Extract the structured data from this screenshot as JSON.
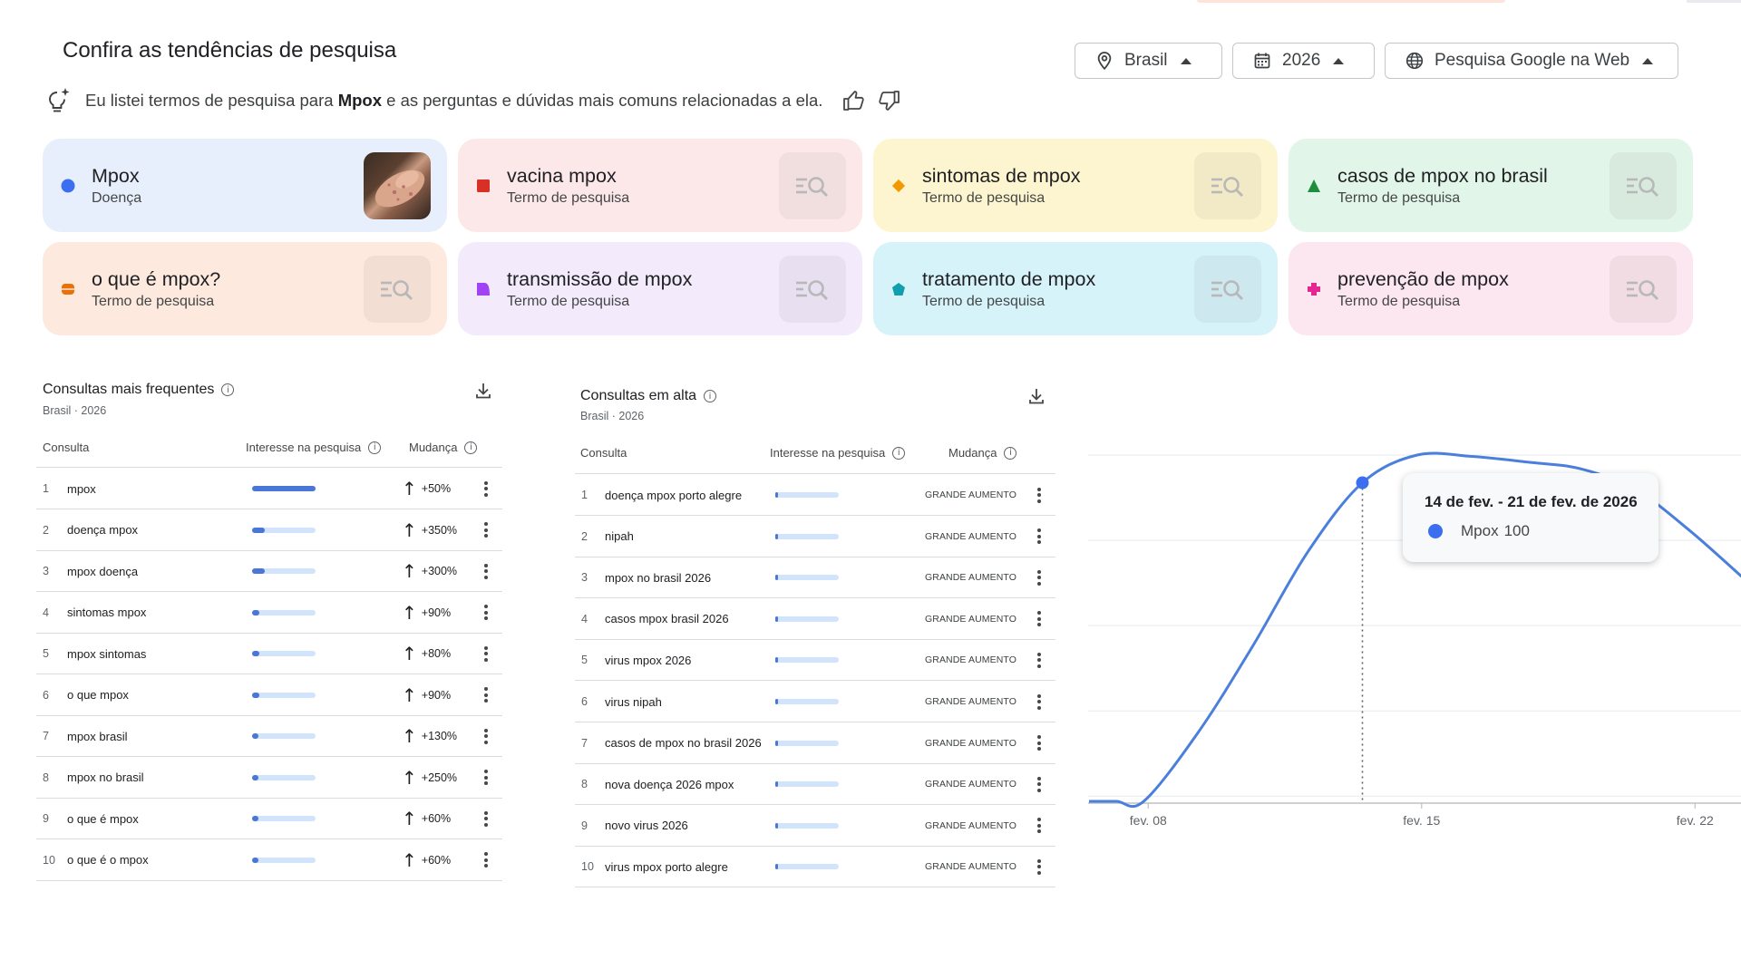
{
  "header": {
    "title": "Confira as tendências de pesquisa",
    "filters": {
      "location": "Brasil",
      "year": "2026",
      "property": "Pesquisa Google na Web"
    }
  },
  "ai_summary": {
    "prefix": "Eu listei termos de pesquisa para ",
    "term": "Mpox",
    "suffix": " e as perguntas e dúvidas mais comuns relacionadas a ela."
  },
  "cards": [
    {
      "title": "Mpox",
      "subtitle": "Doença",
      "bg": "#e8effc",
      "shape": "circle",
      "color": "#3b6ff0",
      "thumb": "photo"
    },
    {
      "title": "vacina mpox",
      "subtitle": "Termo de pesquisa",
      "bg": "#fce8e8",
      "shape": "square",
      "color": "#d93025",
      "thumb": "search-icon"
    },
    {
      "title": "sintomas de mpox",
      "subtitle": "Termo de pesquisa",
      "bg": "#fdf5cf",
      "shape": "diamond",
      "color": "#f29900",
      "thumb": "search-icon"
    },
    {
      "title": "casos de mpox no brasil",
      "subtitle": "Termo de pesquisa",
      "bg": "#e2f5e9",
      "shape": "triangle",
      "color": "#1e8e3e",
      "thumb": "search-icon"
    },
    {
      "title": "o que é mpox?",
      "subtitle": "Termo de pesquisa",
      "bg": "#fde9dd",
      "shape": "rounded",
      "color": "#e8710a",
      "thumb": "search-icon"
    },
    {
      "title": "transmissão de mpox",
      "subtitle": "Termo de pesquisa",
      "bg": "#f3eafc",
      "shape": "leaf",
      "color": "#a142f4",
      "thumb": "search-icon"
    },
    {
      "title": "tratamento de mpox",
      "subtitle": "Termo de pesquisa",
      "bg": "#d7f3fa",
      "shape": "pentagon",
      "color": "#129eaf",
      "thumb": "search-icon"
    },
    {
      "title": "prevenção de mpox",
      "subtitle": "Termo de pesquisa",
      "bg": "#fce6ef",
      "shape": "cross",
      "color": "#e52592",
      "thumb": "search-icon"
    }
  ],
  "top_queries": {
    "title": "Consultas mais frequentes",
    "subtitle": "Brasil · 2026",
    "col_query": "Consulta",
    "col_interest": "Interesse na pesquisa",
    "col_change": "Mudança",
    "rows": [
      {
        "rank": "1",
        "query": "mpox",
        "interest": 1.0,
        "change": "+50%"
      },
      {
        "rank": "2",
        "query": "doença mpox",
        "interest": 0.2,
        "change": "+350%"
      },
      {
        "rank": "3",
        "query": "mpox doença",
        "interest": 0.2,
        "change": "+300%"
      },
      {
        "rank": "4",
        "query": "sintomas mpox",
        "interest": 0.12,
        "change": "+90%"
      },
      {
        "rank": "5",
        "query": "mpox sintomas",
        "interest": 0.12,
        "change": "+80%"
      },
      {
        "rank": "6",
        "query": "o que mpox",
        "interest": 0.12,
        "change": "+90%"
      },
      {
        "rank": "7",
        "query": "mpox brasil",
        "interest": 0.1,
        "change": "+130%"
      },
      {
        "rank": "8",
        "query": "mpox no brasil",
        "interest": 0.1,
        "change": "+250%"
      },
      {
        "rank": "9",
        "query": "o que é mpox",
        "interest": 0.1,
        "change": "+60%"
      },
      {
        "rank": "10",
        "query": "o que é o mpox",
        "interest": 0.1,
        "change": "+60%"
      }
    ]
  },
  "rising_queries": {
    "title": "Consultas em alta",
    "subtitle": "Brasil · 2026",
    "col_query": "Consulta",
    "col_interest": "Interesse na pesquisa",
    "col_change": "Mudança",
    "rows": [
      {
        "rank": "1",
        "query": "doença mpox porto alegre",
        "interest": 0.02,
        "change": "GRANDE AUMENTO"
      },
      {
        "rank": "2",
        "query": "nipah",
        "interest": 0.02,
        "change": "GRANDE AUMENTO"
      },
      {
        "rank": "3",
        "query": "mpox no brasil 2026",
        "interest": 0.02,
        "change": "GRANDE AUMENTO"
      },
      {
        "rank": "4",
        "query": "casos mpox brasil 2026",
        "interest": 0.02,
        "change": "GRANDE AUMENTO"
      },
      {
        "rank": "5",
        "query": "virus mpox 2026",
        "interest": 0.02,
        "change": "GRANDE AUMENTO"
      },
      {
        "rank": "6",
        "query": "virus nipah",
        "interest": 0.02,
        "change": "GRANDE AUMENTO"
      },
      {
        "rank": "7",
        "query": "casos de mpox no brasil 2026",
        "interest": 0.02,
        "change": "GRANDE AUMENTO"
      },
      {
        "rank": "8",
        "query": "nova doença 2026 mpox",
        "interest": 0.02,
        "change": "GRANDE AUMENTO"
      },
      {
        "rank": "9",
        "query": "novo virus 2026",
        "interest": 0.02,
        "change": "GRANDE AUMENTO"
      },
      {
        "rank": "10",
        "query": "virus mpox porto alegre",
        "interest": 0.02,
        "change": "GRANDE AUMENTO"
      }
    ]
  },
  "chart_data": {
    "type": "line",
    "x_ticks": [
      "fev. 08",
      "fev. 15",
      "fev. 22"
    ],
    "series": [
      {
        "name": "Mpox",
        "color": "#4a7fdc",
        "points": [
          [
            0,
            0
          ],
          [
            0.5,
            0
          ],
          [
            1,
            0
          ],
          [
            2,
            20
          ],
          [
            3,
            45
          ],
          [
            4,
            72
          ],
          [
            5,
            92
          ],
          [
            6,
            100
          ],
          [
            7,
            99.6
          ],
          [
            8,
            98
          ],
          [
            9,
            96
          ],
          [
            10,
            90
          ],
          [
            11,
            78
          ],
          [
            12,
            64
          ],
          [
            13,
            50
          ]
        ]
      }
    ],
    "ylim": [
      0,
      100
    ],
    "highlight_index": 6,
    "tooltip": {
      "label": "14 de fev. - 21 de fev. de 2026",
      "series_name": "Mpox",
      "value": "100"
    },
    "grid": true
  }
}
